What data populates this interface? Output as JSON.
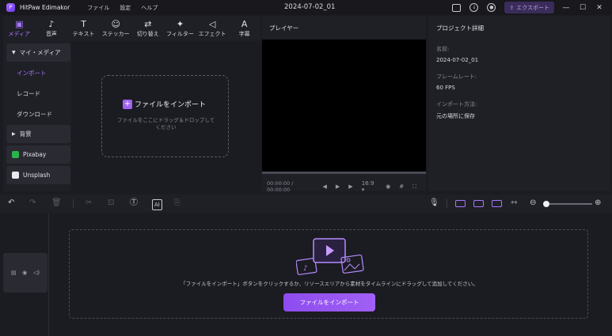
{
  "titlebar": {
    "app_name": "HitPaw Edimakor",
    "menu": [
      "ファイル",
      "設定",
      "ヘルプ"
    ],
    "document_title": "2024-07-02_01",
    "export_label": "エクスポート"
  },
  "toolbar": {
    "tools": [
      {
        "label": "メディア",
        "icon": "media-icon",
        "active": true
      },
      {
        "label": "音声",
        "icon": "music-icon"
      },
      {
        "label": "テキスト",
        "icon": "text-icon"
      },
      {
        "label": "ステッカー",
        "icon": "sticker-icon"
      },
      {
        "label": "切り替え",
        "icon": "transition-icon"
      },
      {
        "label": "フィルター",
        "icon": "filter-icon"
      },
      {
        "label": "エフェクト",
        "icon": "effect-icon"
      },
      {
        "label": "字幕",
        "icon": "subtitle-icon"
      }
    ]
  },
  "sidebar": {
    "my_media": "マイ・メディア",
    "import": "インポート",
    "record": "レコード",
    "download": "ダウンロード",
    "background": "背景",
    "pixabay": "Pixabay",
    "unsplash": "Unsplash"
  },
  "media": {
    "import_button": "ファイルをインポート",
    "hint": "ファイルをここにドラッグ＆ドロップしてください"
  },
  "player": {
    "title": "プレイヤー",
    "current_time": "00:00:00",
    "total_time": "00:00:00",
    "aspect": "16:9"
  },
  "details": {
    "title": "プロジェクト詳細",
    "name_label": "名前:",
    "name_value": "2024-07-02_01",
    "framerate_label": "フレームレート:",
    "framerate_value": "60 FPS",
    "import_method_label": "インポート方法:",
    "import_method_value": "元の場所に保存"
  },
  "timeline": {
    "hint": "「ファイルをインポート」ボタンをクリックするか、リソースエリアから素材をタイムラインにドラッグして追加してください。",
    "import_button": "ファイルをインポート"
  },
  "colors": {
    "accent": "#a678ff",
    "button": "#9a5cf2"
  }
}
